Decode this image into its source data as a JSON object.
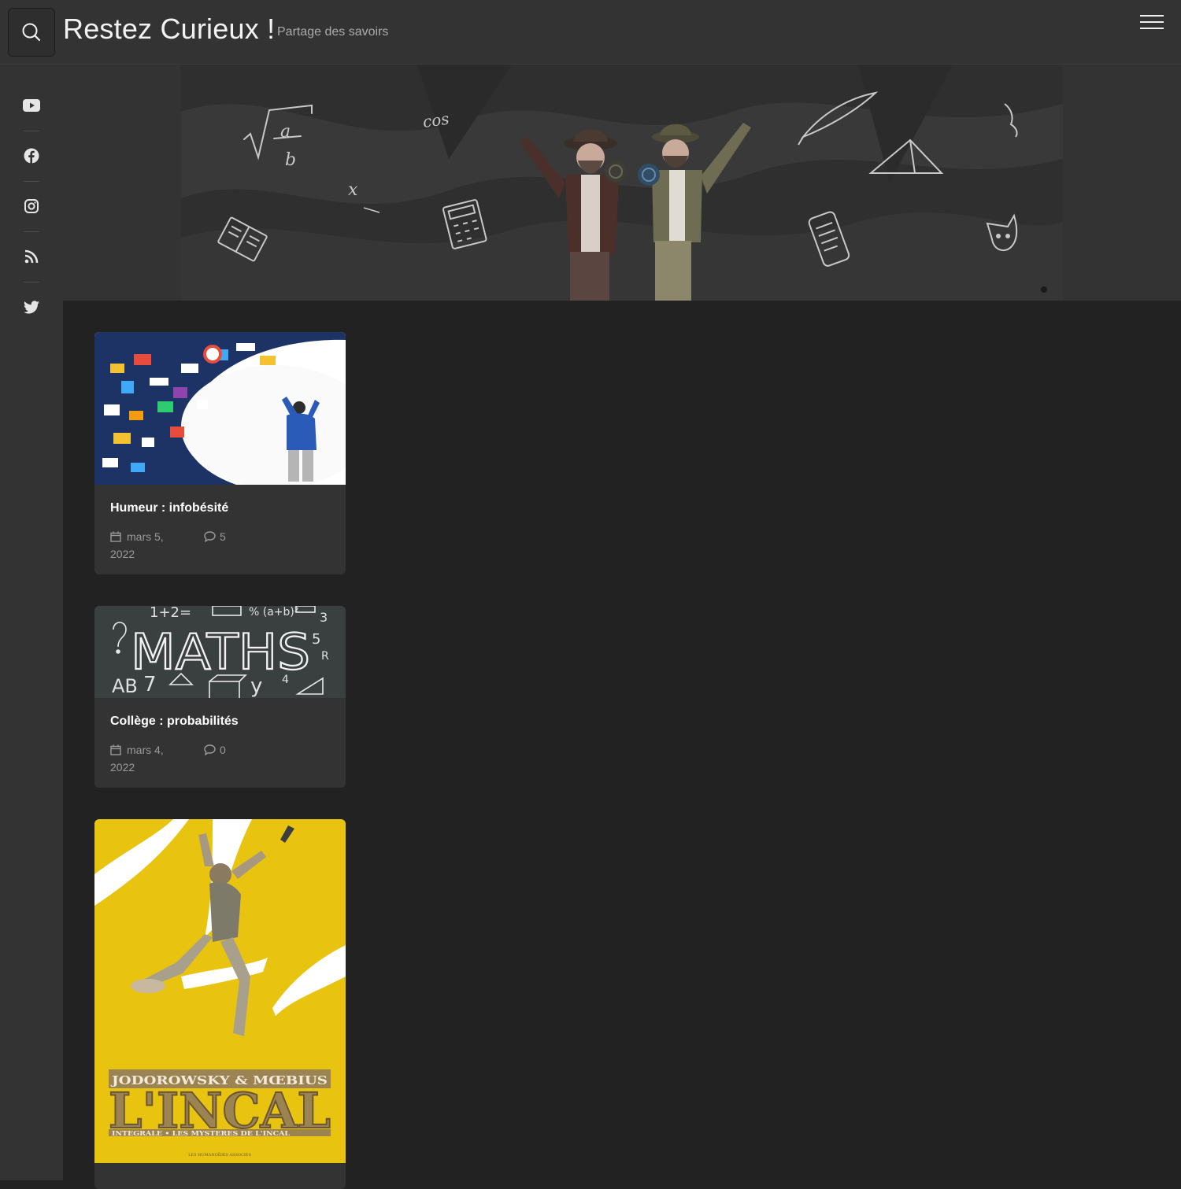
{
  "header": {
    "title": "Restez Curieux !",
    "tagline": "Partage des savoirs"
  },
  "banner": {
    "doodles": {
      "frac_a": "a",
      "frac_b": "b",
      "cos": "cos",
      "x": "x"
    }
  },
  "social": [
    "youtube-icon",
    "facebook-icon",
    "instagram-icon",
    "rss-icon",
    "twitter-icon"
  ],
  "posts": [
    {
      "title": "Humeur : infobésité",
      "date_line1": "mars 5,",
      "date_line2": "2022",
      "comments": "5"
    },
    {
      "title": "Collège : probabilités",
      "date_line1": "mars 4,",
      "date_line2": "2022",
      "comments": "0",
      "image_text": "MATHS"
    },
    {
      "image_text": {
        "authors": "JODOROWSKY & MŒBIUS",
        "title": "L'INCAL",
        "subtitle": "INTEGRALE • LES MYSTERES DE L'INCAL",
        "publisher": "LES HUMANOÏDES ASSOCIÉS"
      }
    }
  ],
  "colors": {
    "page_bg": "#222222",
    "panel_bg": "#333333",
    "card_bg": "#333333",
    "text_light": "#ffffff",
    "text_muted": "#999999",
    "cover_yellow": "#e8c411"
  }
}
